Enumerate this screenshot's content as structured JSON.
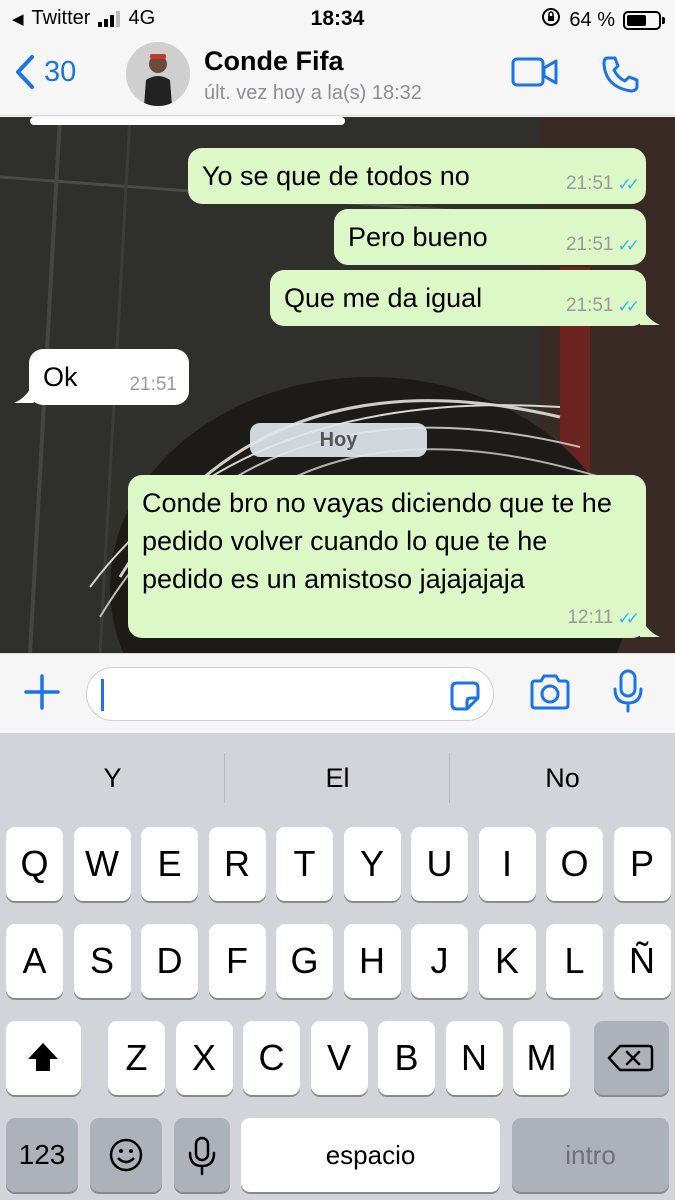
{
  "status_bar": {
    "back_app": "Twitter",
    "network": "4G",
    "time": "18:34",
    "battery": "64 %",
    "battery_level": 0.64
  },
  "header": {
    "back_count": "30",
    "contact_name": "Conde Fifa",
    "last_seen": "últ. vez hoy a la(s) 18:32"
  },
  "messages": [
    {
      "direction": "out",
      "text": "Yo se que de todos no",
      "time": "21:51",
      "read": true
    },
    {
      "direction": "out",
      "text": "Pero bueno",
      "time": "21:51",
      "read": true
    },
    {
      "direction": "out",
      "text": "Que me da igual",
      "time": "21:51",
      "read": true
    },
    {
      "direction": "in",
      "text": "Ok",
      "time": "21:51"
    },
    {
      "direction": "out",
      "text": "Conde bro no vayas diciendo que te he pedido volver cuando lo que te he pedido es un amistoso jajajajaja",
      "time": "12:11",
      "read": true
    }
  ],
  "day_separator": "Hoy",
  "input": {
    "value": "",
    "placeholder": ""
  },
  "keyboard": {
    "suggestions": [
      "Y",
      "El",
      "No"
    ],
    "row1": [
      "Q",
      "W",
      "E",
      "R",
      "T",
      "Y",
      "U",
      "I",
      "O",
      "P"
    ],
    "row2": [
      "A",
      "S",
      "D",
      "F",
      "G",
      "H",
      "J",
      "K",
      "L",
      "Ñ"
    ],
    "row3": [
      "Z",
      "X",
      "C",
      "V",
      "B",
      "N",
      "M"
    ],
    "numbers_key": "123",
    "space_key": "espacio",
    "return_key": "intro"
  },
  "colors": {
    "accent": "#1a73e8",
    "outgoing_bubble": "#dcf8c6",
    "incoming_bubble": "#ffffff",
    "read_ticks": "#34b7f1"
  },
  "icons": [
    "back-chevron-icon",
    "video-call-icon",
    "phone-icon",
    "plus-icon",
    "sticker-icon",
    "camera-icon",
    "microphone-icon",
    "shift-icon",
    "backspace-icon",
    "emoji-icon",
    "keyboard-mic-icon"
  ]
}
